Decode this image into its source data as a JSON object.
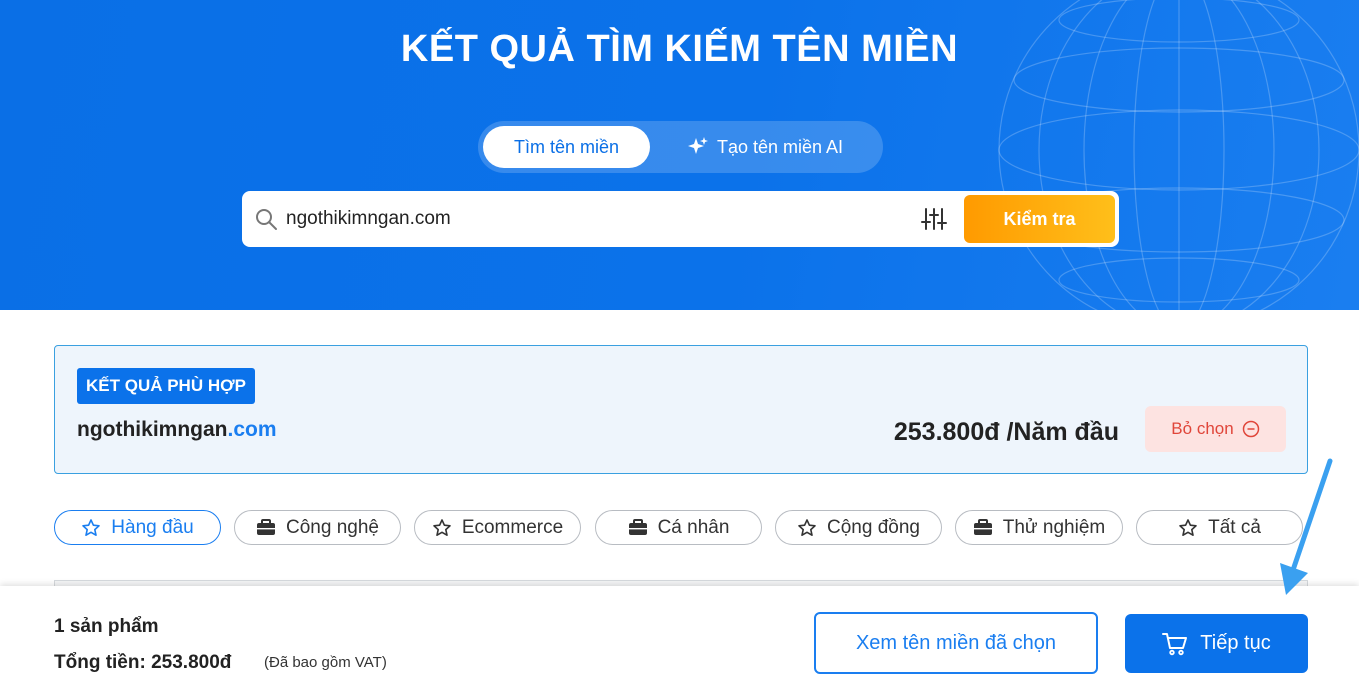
{
  "hero": {
    "title": "KẾT QUẢ TÌM KIẾM TÊN MIỀN",
    "tabs": {
      "search": "Tìm tên miền",
      "ai": "Tạo tên miền AI"
    }
  },
  "search": {
    "value": "ngothikimngan.com",
    "button": "Kiểm tra",
    "icon": "search-icon",
    "filter_icon": "sliders-icon"
  },
  "result": {
    "badge": "KẾT QUẢ PHÙ HỢP",
    "domain_base": "ngothikimngan",
    "domain_tld": ".com",
    "price": "253.800đ /Năm đầu",
    "deselect": "Bỏ chọn"
  },
  "categories": [
    {
      "label": "Hàng đầu",
      "icon": "star-icon",
      "active": true
    },
    {
      "label": "Công nghệ",
      "icon": "briefcase-icon",
      "active": false
    },
    {
      "label": "Ecommerce",
      "icon": "star-icon",
      "active": false
    },
    {
      "label": "Cá nhân",
      "icon": "briefcase-icon",
      "active": false
    },
    {
      "label": "Cộng đồng",
      "icon": "star-icon",
      "active": false
    },
    {
      "label": "Thử nghiệm",
      "icon": "briefcase-icon",
      "active": false
    },
    {
      "label": "Tất cả",
      "icon": "star-icon",
      "active": false
    }
  ],
  "footer": {
    "count": "1 sản phẩm",
    "total": "Tổng tiền: 253.800đ",
    "vat": "(Đã bao gồm VAT)",
    "view_selected": "Xem tên miền đã chọn",
    "continue": "Tiếp tục"
  },
  "colors": {
    "primary": "#0b72ea",
    "accent_orange": "#ff9a00",
    "danger": "#e0463a",
    "annotation_arrow": "#3aa0f0"
  }
}
